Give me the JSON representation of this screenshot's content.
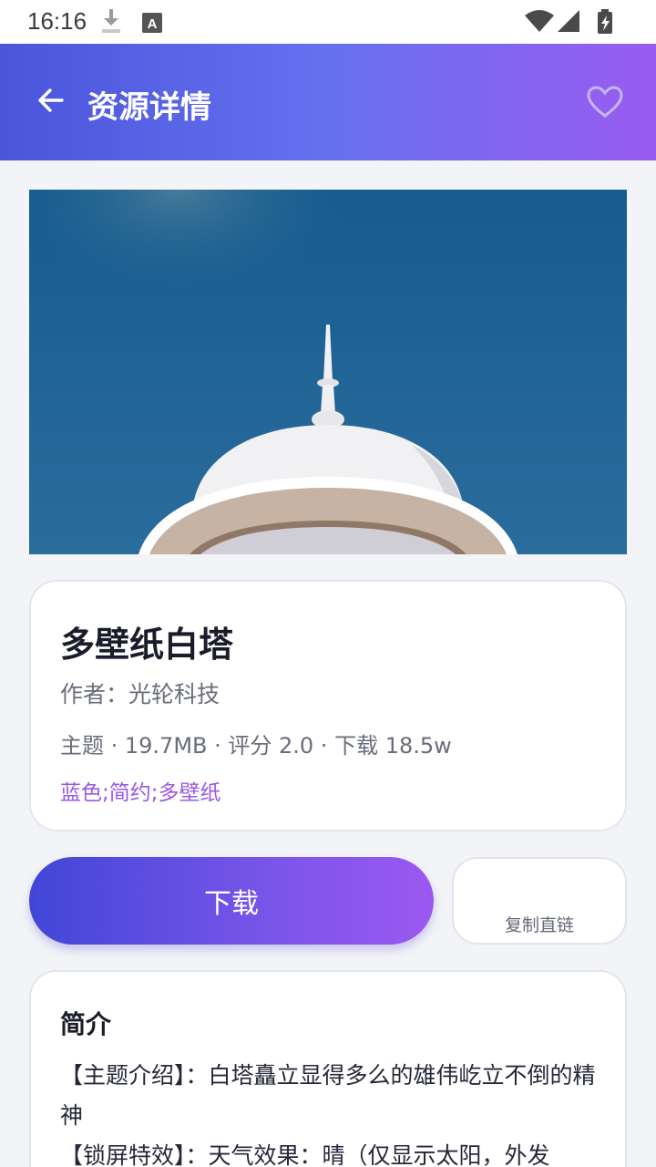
{
  "status_bar": {
    "time": "16:16",
    "icons_left": [
      "download-icon",
      "keyboard-a-icon"
    ],
    "icons_right": [
      "wifi-icon",
      "signal-icon",
      "battery-charging-icon"
    ]
  },
  "app_bar": {
    "title": "资源详情",
    "back_icon": "arrow-left-icon",
    "favorite_icon": "heart-outline-icon"
  },
  "resource": {
    "title": "多壁纸白塔",
    "author": "作者：光轮科技",
    "meta": "主题 · 19.7MB · 评分 2.0 · 下载 18.5w",
    "tags": "蓝色;简约;多壁纸"
  },
  "actions": {
    "download_label": "下载",
    "copy_link_label": "复制直链"
  },
  "intro": {
    "heading": "简介",
    "lines": [
      "【主题介绍】：白塔矗立显得多么的雄伟屹立不倒的精神",
      "【锁屏特效】：天气效果：晴（仅显示太阳，外发"
    ]
  },
  "colors": {
    "app_bar_gradient": [
      "#4b55dc",
      "#6571ef",
      "#9a5cf0"
    ],
    "accent_tag": "#9a58e6",
    "banner_sky": "#1f5f94"
  }
}
